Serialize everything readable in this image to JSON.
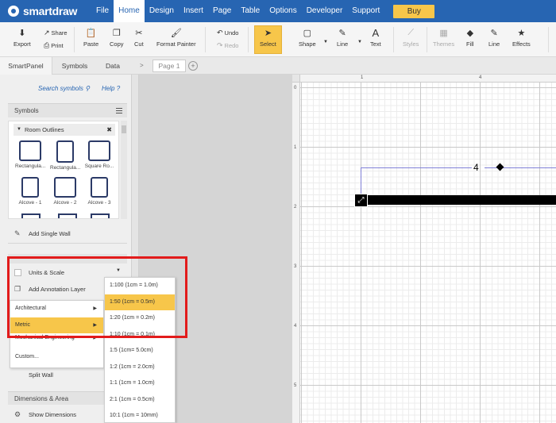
{
  "app": {
    "logo_text": "smartdraw",
    "menu": [
      "File",
      "Home",
      "Design",
      "Insert",
      "Page",
      "Table",
      "Options",
      "Developer",
      "Support"
    ],
    "active_menu": "Home",
    "buy_label": "Buy"
  },
  "ribbon": {
    "export": "Export",
    "share": "Share",
    "print": "Print",
    "paste": "Paste",
    "copy": "Copy",
    "cut": "Cut",
    "format_painter": "Format Painter",
    "undo": "Undo",
    "redo": "Redo",
    "select": "Select",
    "shape": "Shape",
    "line": "Line",
    "text": "Text",
    "styles": "Styles",
    "themes": "Themes",
    "fill": "Fill",
    "line2": "Line",
    "effects": "Effects"
  },
  "tabs": {
    "smartpanel": "SmartPanel",
    "symbols": "Symbols",
    "data": "Data",
    "arrow": ">",
    "page": "Page 1",
    "add": "+"
  },
  "panel": {
    "search_symbols": "Search symbols",
    "help": "Help",
    "symbols_header": "Symbols",
    "library_name": "Room Outlines",
    "symbols": [
      "Rectangula...",
      "Rectangula...",
      "Square Ro...",
      "Alcove - 1",
      "Alcove - 2",
      "Alcove - 3"
    ],
    "add_single_wall": "Add Single Wall",
    "units_scale": "Units & Scale",
    "add_annotation_layer": "Add Annotation Layer",
    "split_wall": "Split Wall",
    "dimensions_area": "Dimensions & Area",
    "show_dimensions": "Show Dimensions"
  },
  "units_menu": {
    "items": [
      "Architectural",
      "Metric",
      "Mechanical Engineering",
      "Custom..."
    ],
    "highlighted": "Metric"
  },
  "scale_menu": {
    "items": [
      "1:100 (1cm = 1.0m)",
      "1:50 (1cm = 0.5m)",
      "1:20 (1cm = 0.2m)",
      "1:10 (1cm = 0.1m)",
      "1:5 (1cm= 5.0cm)",
      "1:2 (1cm = 2.0cm)",
      "1:1 (1cm = 1.0cm)",
      "2:1 (1cm = 0.5cm)",
      "10:1 (1cm = 10mm)"
    ],
    "highlighted": "1:50 (1cm = 0.5m)"
  },
  "canvas": {
    "hruler_labels": [
      "1",
      "4"
    ],
    "vruler_labels": [
      "0",
      "1",
      "2",
      "3",
      "4",
      "5"
    ],
    "dimension_label": "4"
  },
  "colors": {
    "menubar": "#2765b2",
    "highlight": "#f7c64a",
    "annotation_box": "#e21b1b"
  }
}
